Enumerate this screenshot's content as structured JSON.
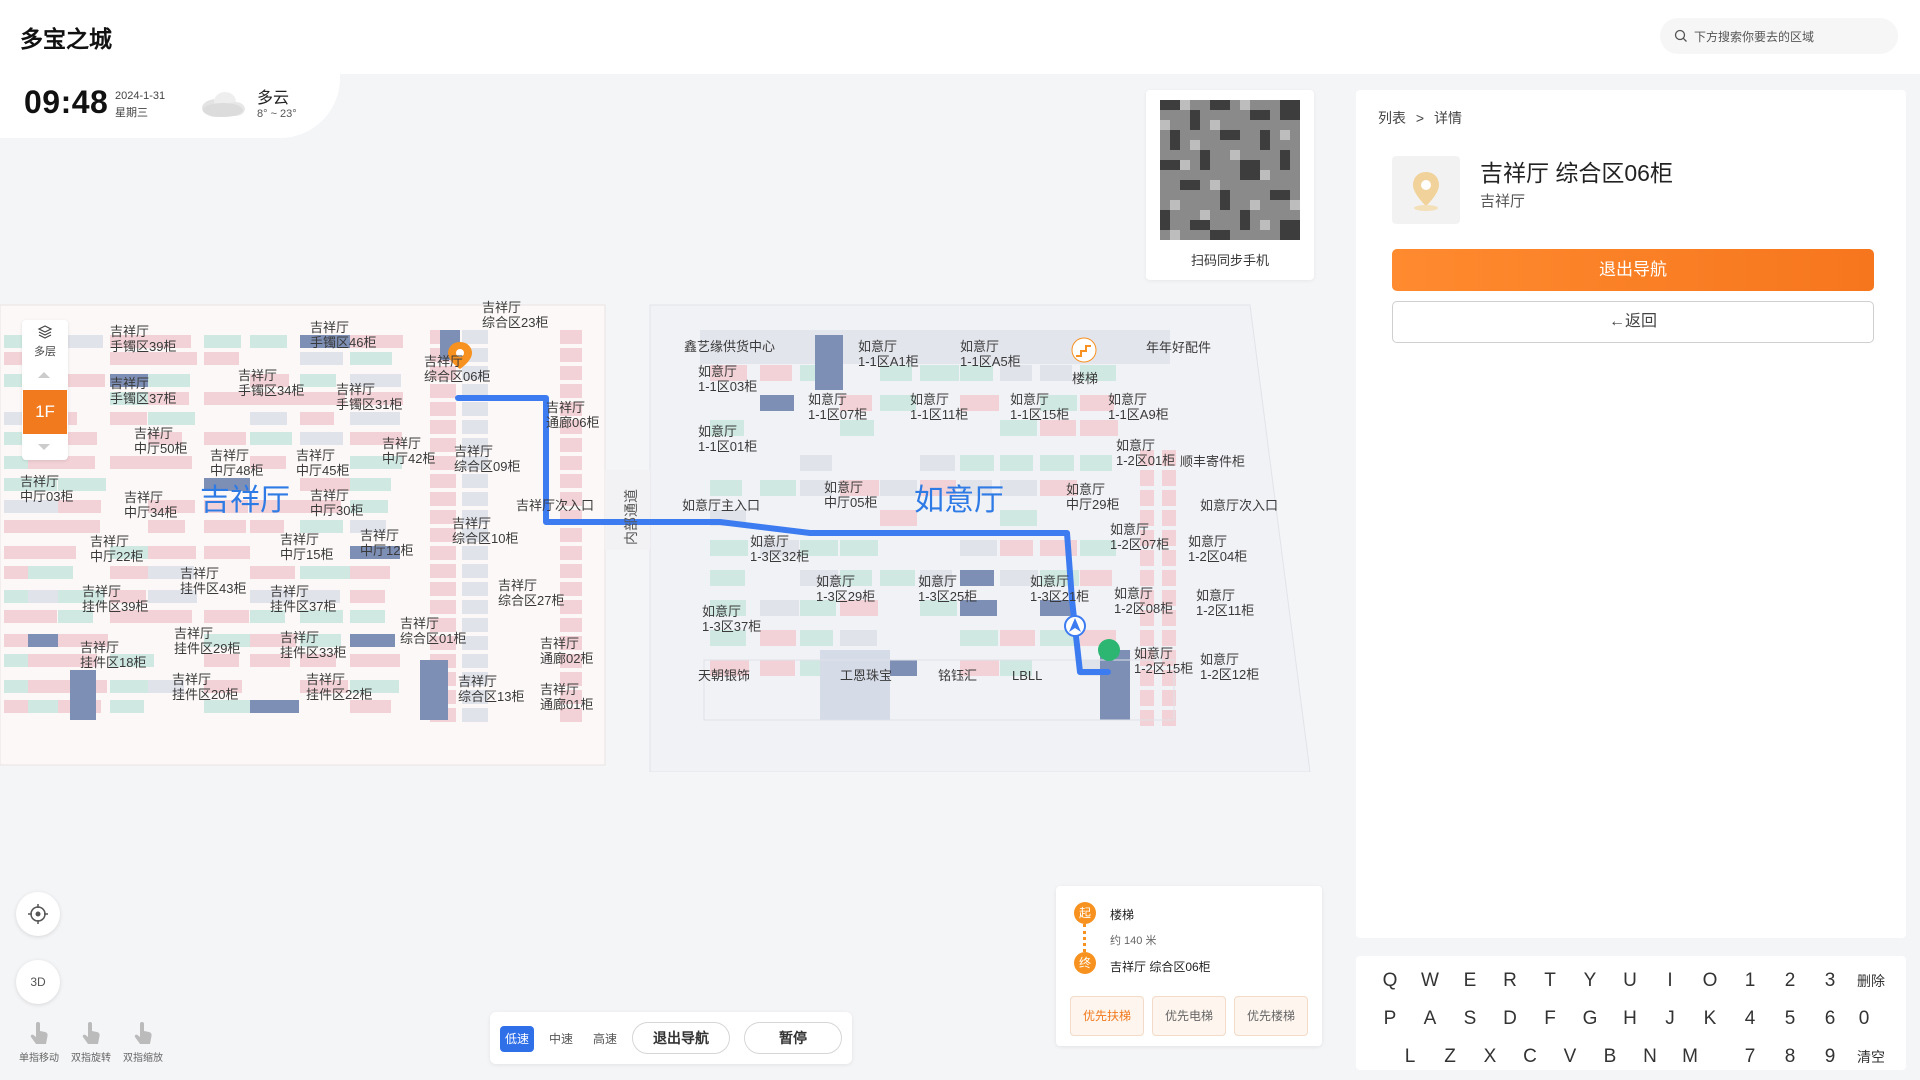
{
  "app": {
    "title": "多宝之城"
  },
  "search": {
    "placeholder": "下方搜索你要去的区域"
  },
  "clock": {
    "time": "09:48",
    "date": "2024-1-31",
    "weekday": "星期三",
    "weather": "多云",
    "temp": "8° ~ 23°"
  },
  "qr": {
    "label": "扫码同步手机"
  },
  "detail": {
    "breadcrumb": {
      "list": "列表",
      "sep": ">",
      "current": "详情"
    },
    "title": "吉祥厅 综合区06柜",
    "subtitle": "吉祥厅",
    "exit_nav": "退出导航",
    "back": "←返回"
  },
  "keyboard": {
    "row1": [
      "Q",
      "W",
      "E",
      "R",
      "T",
      "Y",
      "U",
      "I",
      "O",
      "1",
      "2",
      "3",
      "删除"
    ],
    "row2": [
      "P",
      "A",
      "S",
      "D",
      "F",
      "G",
      "H",
      "J",
      "K",
      "4",
      "5",
      "6",
      "0"
    ],
    "row3": [
      "L",
      "Z",
      "X",
      "C",
      "V",
      "B",
      "N",
      "M",
      "7",
      "8",
      "9",
      "清空"
    ]
  },
  "floor": {
    "layers_label": "多层",
    "current": "1F"
  },
  "controls": {
    "locate_icon": "crosshair-icon",
    "view_3d": "3D"
  },
  "gestures": [
    {
      "label": "单指移动",
      "icon": "hand-icon"
    },
    {
      "label": "双指旋转",
      "icon": "hand-icon"
    },
    {
      "label": "双指缩放",
      "icon": "hand-icon"
    }
  ],
  "nav": {
    "speeds": [
      "低速",
      "中速",
      "高速"
    ],
    "active_speed": "低速",
    "exit": "退出导航",
    "pause": "暂停"
  },
  "route": {
    "start_badge": "起",
    "end_badge": "终",
    "start": "楼梯",
    "distance": "约 140 米",
    "end": "吉祥厅 综合区06柜",
    "prefs": [
      "优先扶梯",
      "优先电梯",
      "优先楼梯"
    ],
    "active_pref": "优先扶梯"
  },
  "map": {
    "hall_left": "吉祥厅",
    "hall_right": "如意厅",
    "road": "内部通道",
    "colors": {
      "route": "#3d7cf0",
      "hall_text": "#2e7be6",
      "pink": "#f2d2d6",
      "green": "#cfe9e2",
      "gray": "#e1e3ea",
      "navy": "#7e8fb5"
    },
    "labels_left": [
      "吉祥厅\n手镯区39柜",
      "吉祥厅\n手镯区46柜",
      "吉祥厅\n综合区23柜",
      "吉祥厅\n手镯区37柜",
      "吉祥厅\n手镯区34柜",
      "吉祥厅\n手镯区31柜",
      "吉祥厅\n综合区06柜",
      "吉祥厅\n通廊06柜",
      "吉祥厅\n中厅50柜",
      "吉祥厅\n中厅48柜",
      "吉祥厅\n中厅45柜",
      "吉祥厅\n中厅42柜",
      "吉祥厅\n综合区09柜",
      "吉祥厅\n中厅03柜",
      "吉祥厅\n中厅34柜",
      "吉祥厅\n中厅30柜",
      "吉祥厅次入口",
      "吉祥厅\n中厅22柜",
      "吉祥厅\n中厅15柜",
      "吉祥厅\n中厅12柜",
      "吉祥厅\n综合区10柜",
      "吉祥厅\n挂件区43柜",
      "吉祥厅\n挂件区37柜",
      "吉祥厅\n综合区27柜",
      "吉祥厅\n挂件区39柜",
      "吉祥厅\n综合区01柜",
      "吉祥厅\n挂件区29柜",
      "吉祥厅\n挂件区33柜",
      "吉祥厅\n通廊02柜",
      "吉祥厅\n挂件区18柜",
      "吉祥厅\n挂件区20柜",
      "吉祥厅\n挂件区22柜",
      "吉祥厅\n综合区13柜",
      "吉祥厅\n通廊01柜"
    ],
    "labels_right": [
      "鑫艺缘供货中心",
      "如意厅\n1-1区A1柜",
      "如意厅\n1-1区A5柜",
      "楼梯",
      "年年好配件",
      "如意厅\n1-1区03柜",
      "如意厅\n1-1区07柜",
      "如意厅\n1-1区11柜",
      "如意厅\n1-1区15柜",
      "如意厅\n1-1区A9柜",
      "如意厅\n1-1区01柜",
      "如意厅\n1-2区01柜",
      "顺丰寄件柜",
      "如意厅主入口",
      "如意厅\n中厅05柜",
      "如意厅\n中厅29柜",
      "如意厅次入口",
      "如意厅\n1-3区32柜",
      "如意厅\n1-2区07柜",
      "如意厅\n1-2区04柜",
      "如意厅\n1-3区29柜",
      "如意厅\n1-3区25柜",
      "如意厅\n1-3区21柜",
      "如意厅\n1-2区08柜",
      "如意厅\n1-2区11柜",
      "如意厅\n1-3区37柜",
      "天朝银饰",
      "工恩珠宝",
      "铭钰汇",
      "LBLL",
      "如意厅\n1-2区15柜",
      "如意厅\n1-2区12柜"
    ]
  }
}
